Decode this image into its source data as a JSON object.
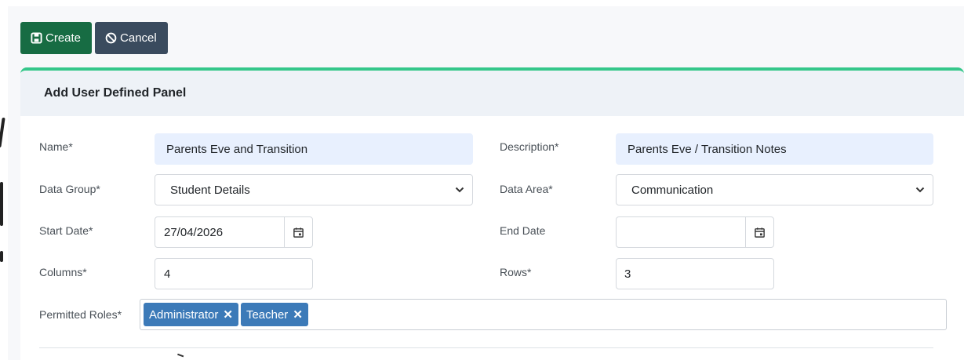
{
  "toolbar": {
    "create_label": "Create",
    "cancel_label": "Cancel"
  },
  "panel": {
    "title": "Add User Defined Panel"
  },
  "form": {
    "name": {
      "label": "Name*",
      "value": "Parents Eve and Transition"
    },
    "description": {
      "label": "Description*",
      "value": "Parents Eve / Transition Notes"
    },
    "data_group": {
      "label": "Data Group*",
      "value": "Student Details"
    },
    "data_area": {
      "label": "Data Area*",
      "value": "Communication"
    },
    "start_date": {
      "label": "Start Date*",
      "value": "27/04/2026"
    },
    "end_date": {
      "label": "End Date",
      "value": ""
    },
    "columns": {
      "label": "Columns*",
      "value": "4"
    },
    "rows": {
      "label": "Rows*",
      "value": "3"
    },
    "permitted_roles": {
      "label": "Permitted Roles*",
      "tags": [
        "Administrator",
        "Teacher"
      ],
      "remove_glyph": "✕"
    }
  },
  "colors": {
    "create_button": "#176c43",
    "cancel_button": "#3a4b5e",
    "card_accent": "#35c78a",
    "tag_bg": "#3c7ab8",
    "filled_input_bg": "#e8f0fe"
  },
  "icons": {
    "create": "save-icon",
    "cancel": "ban-icon",
    "date": "calendar-icon",
    "select": "chevron-down-icon"
  }
}
